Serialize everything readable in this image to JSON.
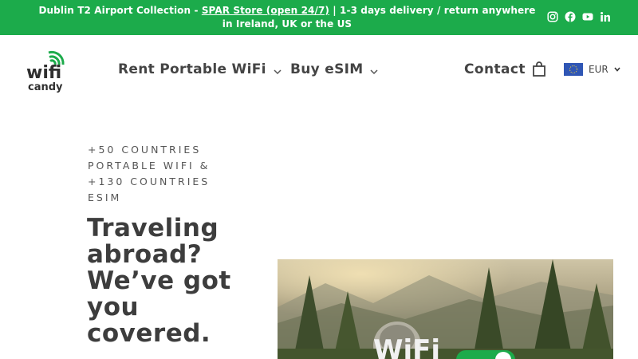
{
  "announcement": {
    "prefix": "Dublin T2 Airport Collection - ",
    "link": "SPAR Store (open 24/7)",
    "suffix": " | 1-3 days delivery / return anywhere in Ireland, UK or the US"
  },
  "social_icons": [
    "instagram-icon",
    "facebook-icon",
    "youtube-icon",
    "linkedin-icon"
  ],
  "logo": {
    "line1": "wifi",
    "line2": "candy"
  },
  "nav": {
    "items": [
      {
        "label": "Rent Portable WiFi"
      },
      {
        "label": "Buy eSIM"
      }
    ],
    "contact": "Contact",
    "currency": "EUR"
  },
  "hero": {
    "eyebrow": "+50 countries portable WiFi & +130 countries eSIM",
    "headline": "Traveling abroad? We’ve got you covered.",
    "image_text": "WiFi"
  },
  "colors": {
    "brand_green": "#1cab4b",
    "text_dark": "#3d3d3d"
  }
}
